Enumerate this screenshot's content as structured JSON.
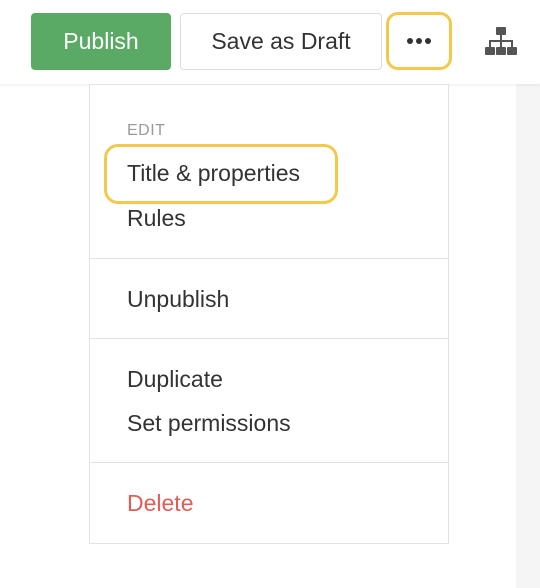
{
  "toolbar": {
    "publish_label": "Publish",
    "draft_label": "Save as Draft",
    "more_icon": "more-horizontal-icon",
    "sitemap_icon": "sitemap-icon"
  },
  "menu": {
    "sections": [
      {
        "label": "EDIT",
        "items": [
          "Title & properties",
          "Rules"
        ]
      },
      {
        "items": [
          "Unpublish"
        ]
      },
      {
        "items": [
          "Duplicate",
          "Set permissions"
        ]
      },
      {
        "items": [
          "Delete"
        ]
      }
    ]
  },
  "colors": {
    "publish_bg": "#5aaa65",
    "highlight": "#f2c94c",
    "danger": "#e05d55"
  }
}
